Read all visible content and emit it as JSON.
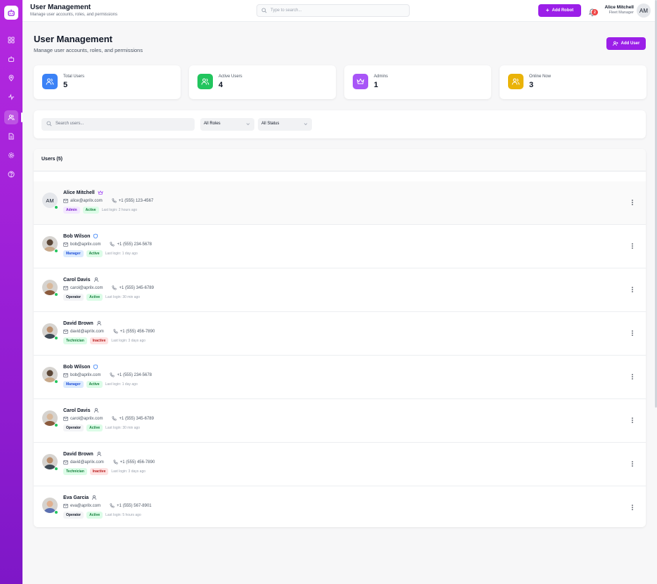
{
  "colors": {
    "brand": "#9b1fe8",
    "online": "#22c55e"
  },
  "sidebar": {
    "logo_icon": "robot-icon",
    "items": [
      {
        "icon": "dashboard-grid-icon"
      },
      {
        "icon": "robot-icon"
      },
      {
        "icon": "map-pin-icon"
      },
      {
        "icon": "activity-icon"
      },
      {
        "icon": "users-icon",
        "active": true
      },
      {
        "icon": "document-icon"
      },
      {
        "icon": "settings-icon"
      },
      {
        "icon": "help-circle-icon"
      }
    ]
  },
  "topbar": {
    "title": "User Management",
    "subtitle": "Manage user accounts, roles, and permissions",
    "search_placeholder": "Type to search...",
    "add_robot_label": "Add Robot",
    "notification_count": "2",
    "user_name": "Alice Mitchell",
    "user_role": "Fleet Manager",
    "user_initials": "AM"
  },
  "page": {
    "title": "User Management",
    "subtitle": "Manage user accounts, roles, and permissions",
    "add_user_label": "Add User"
  },
  "stats": [
    {
      "label": "Total Users",
      "value": "5",
      "color": "#3b82f6"
    },
    {
      "label": "Active Users",
      "value": "4",
      "color": "#22c55e"
    },
    {
      "label": "Admins",
      "value": "1",
      "color": "#a855f7"
    },
    {
      "label": "Online Now",
      "value": "3",
      "color": "#eab308"
    }
  ],
  "filters": {
    "search_placeholder": "Search users...",
    "role_selected": "All Roles",
    "status_selected": "All Status"
  },
  "users_list": {
    "heading": "Users (5)",
    "rows": [
      {
        "name": "Alice Mitchell",
        "role_icon": "crown-icon",
        "email": "alice@aprilx.com",
        "phone": "+1 (555) 123-4567",
        "role": "Admin",
        "status": "Active",
        "last_login": "Last login: 2 hours ago",
        "initials": "AM"
      },
      {
        "name": "Bob Wilson",
        "role_icon": "shield-icon",
        "email": "bob@aprilx.com",
        "phone": "+1 (555) 234-5678",
        "role": "Manager",
        "status": "Active",
        "last_login": "Last login: 1 day ago"
      },
      {
        "name": "Carol Davis",
        "role_icon": "user-icon",
        "email": "carol@aprilx.com",
        "phone": "+1 (555) 345-6789",
        "role": "Operator",
        "status": "Active",
        "last_login": "Last login: 30 min ago"
      },
      {
        "name": "David Brown",
        "role_icon": "user-icon",
        "email": "david@aprilx.com",
        "phone": "+1 (555) 456-7890",
        "role": "Technician",
        "status": "Inactive",
        "last_login": "Last login: 3 days ago"
      },
      {
        "name": "Bob Wilson",
        "role_icon": "shield-icon",
        "email": "bob@aprilx.com",
        "phone": "+1 (555) 234-5678",
        "role": "Manager",
        "status": "Active",
        "last_login": "Last login: 1 day ago"
      },
      {
        "name": "Carol Davis",
        "role_icon": "user-icon",
        "email": "carol@aprilx.com",
        "phone": "+1 (555) 345-6789",
        "role": "Operator",
        "status": "Active",
        "last_login": "Last login: 30 min ago"
      },
      {
        "name": "David Brown",
        "role_icon": "user-icon",
        "email": "david@aprilx.com",
        "phone": "+1 (555) 456-7890",
        "role": "Technician",
        "status": "Inactive",
        "last_login": "Last login: 3 days ago"
      },
      {
        "name": "Eva Garcia",
        "role_icon": "user-icon",
        "email": "eva@aprilx.com",
        "phone": "+1 (555) 567-8901",
        "role": "Operator",
        "status": "Active",
        "last_login": "Last login: 5 hours ago"
      }
    ]
  }
}
